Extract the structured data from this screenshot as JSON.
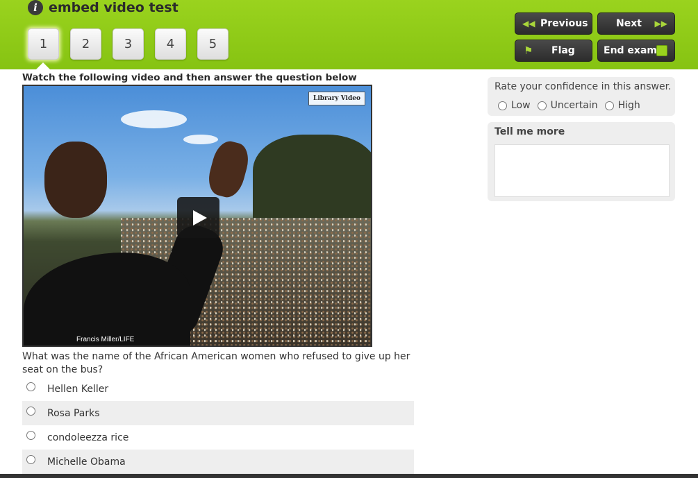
{
  "header": {
    "title": "embed video test",
    "info_icon": "i",
    "question_numbers": [
      "1",
      "2",
      "3",
      "4",
      "5"
    ],
    "active_question": "1",
    "buttons": {
      "previous": "Previous",
      "next": "Next",
      "flag": "Flag",
      "end_exam": "End exam"
    },
    "colors": {
      "header_green": "#9ad31e",
      "button_dark": "#333333"
    }
  },
  "main": {
    "instruction": "Watch the following video and then answer the question below",
    "video": {
      "watermark": "Library Video",
      "credit": "Francis Miller/LIFE"
    },
    "question": "What was the name of the African American women who refused to give up her seat on the bus?",
    "options": [
      "Hellen Keller",
      "Rosa Parks",
      "condoleezza rice",
      "Michelle Obama"
    ]
  },
  "confidence": {
    "title": "Rate your confidence in this answer.",
    "options": [
      "Low",
      "Uncertain",
      "High"
    ]
  },
  "tell_more": {
    "title": "Tell me more",
    "value": ""
  }
}
